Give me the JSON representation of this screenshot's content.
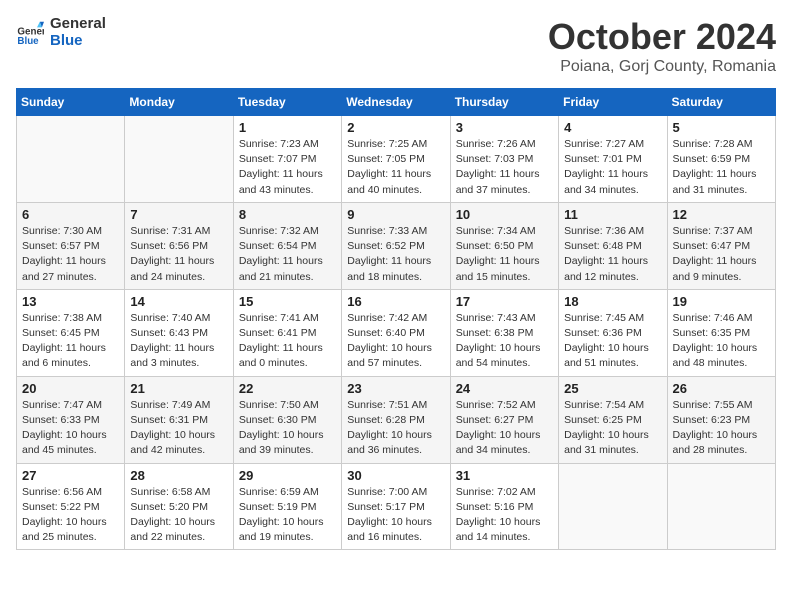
{
  "header": {
    "logo_general": "General",
    "logo_blue": "Blue",
    "month_title": "October 2024",
    "location": "Poiana, Gorj County, Romania"
  },
  "days_of_week": [
    "Sunday",
    "Monday",
    "Tuesday",
    "Wednesday",
    "Thursday",
    "Friday",
    "Saturday"
  ],
  "weeks": [
    [
      {
        "day": "",
        "sunrise": "",
        "sunset": "",
        "daylight": ""
      },
      {
        "day": "",
        "sunrise": "",
        "sunset": "",
        "daylight": ""
      },
      {
        "day": "1",
        "sunrise": "Sunrise: 7:23 AM",
        "sunset": "Sunset: 7:07 PM",
        "daylight": "Daylight: 11 hours and 43 minutes."
      },
      {
        "day": "2",
        "sunrise": "Sunrise: 7:25 AM",
        "sunset": "Sunset: 7:05 PM",
        "daylight": "Daylight: 11 hours and 40 minutes."
      },
      {
        "day": "3",
        "sunrise": "Sunrise: 7:26 AM",
        "sunset": "Sunset: 7:03 PM",
        "daylight": "Daylight: 11 hours and 37 minutes."
      },
      {
        "day": "4",
        "sunrise": "Sunrise: 7:27 AM",
        "sunset": "Sunset: 7:01 PM",
        "daylight": "Daylight: 11 hours and 34 minutes."
      },
      {
        "day": "5",
        "sunrise": "Sunrise: 7:28 AM",
        "sunset": "Sunset: 6:59 PM",
        "daylight": "Daylight: 11 hours and 31 minutes."
      }
    ],
    [
      {
        "day": "6",
        "sunrise": "Sunrise: 7:30 AM",
        "sunset": "Sunset: 6:57 PM",
        "daylight": "Daylight: 11 hours and 27 minutes."
      },
      {
        "day": "7",
        "sunrise": "Sunrise: 7:31 AM",
        "sunset": "Sunset: 6:56 PM",
        "daylight": "Daylight: 11 hours and 24 minutes."
      },
      {
        "day": "8",
        "sunrise": "Sunrise: 7:32 AM",
        "sunset": "Sunset: 6:54 PM",
        "daylight": "Daylight: 11 hours and 21 minutes."
      },
      {
        "day": "9",
        "sunrise": "Sunrise: 7:33 AM",
        "sunset": "Sunset: 6:52 PM",
        "daylight": "Daylight: 11 hours and 18 minutes."
      },
      {
        "day": "10",
        "sunrise": "Sunrise: 7:34 AM",
        "sunset": "Sunset: 6:50 PM",
        "daylight": "Daylight: 11 hours and 15 minutes."
      },
      {
        "day": "11",
        "sunrise": "Sunrise: 7:36 AM",
        "sunset": "Sunset: 6:48 PM",
        "daylight": "Daylight: 11 hours and 12 minutes."
      },
      {
        "day": "12",
        "sunrise": "Sunrise: 7:37 AM",
        "sunset": "Sunset: 6:47 PM",
        "daylight": "Daylight: 11 hours and 9 minutes."
      }
    ],
    [
      {
        "day": "13",
        "sunrise": "Sunrise: 7:38 AM",
        "sunset": "Sunset: 6:45 PM",
        "daylight": "Daylight: 11 hours and 6 minutes."
      },
      {
        "day": "14",
        "sunrise": "Sunrise: 7:40 AM",
        "sunset": "Sunset: 6:43 PM",
        "daylight": "Daylight: 11 hours and 3 minutes."
      },
      {
        "day": "15",
        "sunrise": "Sunrise: 7:41 AM",
        "sunset": "Sunset: 6:41 PM",
        "daylight": "Daylight: 11 hours and 0 minutes."
      },
      {
        "day": "16",
        "sunrise": "Sunrise: 7:42 AM",
        "sunset": "Sunset: 6:40 PM",
        "daylight": "Daylight: 10 hours and 57 minutes."
      },
      {
        "day": "17",
        "sunrise": "Sunrise: 7:43 AM",
        "sunset": "Sunset: 6:38 PM",
        "daylight": "Daylight: 10 hours and 54 minutes."
      },
      {
        "day": "18",
        "sunrise": "Sunrise: 7:45 AM",
        "sunset": "Sunset: 6:36 PM",
        "daylight": "Daylight: 10 hours and 51 minutes."
      },
      {
        "day": "19",
        "sunrise": "Sunrise: 7:46 AM",
        "sunset": "Sunset: 6:35 PM",
        "daylight": "Daylight: 10 hours and 48 minutes."
      }
    ],
    [
      {
        "day": "20",
        "sunrise": "Sunrise: 7:47 AM",
        "sunset": "Sunset: 6:33 PM",
        "daylight": "Daylight: 10 hours and 45 minutes."
      },
      {
        "day": "21",
        "sunrise": "Sunrise: 7:49 AM",
        "sunset": "Sunset: 6:31 PM",
        "daylight": "Daylight: 10 hours and 42 minutes."
      },
      {
        "day": "22",
        "sunrise": "Sunrise: 7:50 AM",
        "sunset": "Sunset: 6:30 PM",
        "daylight": "Daylight: 10 hours and 39 minutes."
      },
      {
        "day": "23",
        "sunrise": "Sunrise: 7:51 AM",
        "sunset": "Sunset: 6:28 PM",
        "daylight": "Daylight: 10 hours and 36 minutes."
      },
      {
        "day": "24",
        "sunrise": "Sunrise: 7:52 AM",
        "sunset": "Sunset: 6:27 PM",
        "daylight": "Daylight: 10 hours and 34 minutes."
      },
      {
        "day": "25",
        "sunrise": "Sunrise: 7:54 AM",
        "sunset": "Sunset: 6:25 PM",
        "daylight": "Daylight: 10 hours and 31 minutes."
      },
      {
        "day": "26",
        "sunrise": "Sunrise: 7:55 AM",
        "sunset": "Sunset: 6:23 PM",
        "daylight": "Daylight: 10 hours and 28 minutes."
      }
    ],
    [
      {
        "day": "27",
        "sunrise": "Sunrise: 6:56 AM",
        "sunset": "Sunset: 5:22 PM",
        "daylight": "Daylight: 10 hours and 25 minutes."
      },
      {
        "day": "28",
        "sunrise": "Sunrise: 6:58 AM",
        "sunset": "Sunset: 5:20 PM",
        "daylight": "Daylight: 10 hours and 22 minutes."
      },
      {
        "day": "29",
        "sunrise": "Sunrise: 6:59 AM",
        "sunset": "Sunset: 5:19 PM",
        "daylight": "Daylight: 10 hours and 19 minutes."
      },
      {
        "day": "30",
        "sunrise": "Sunrise: 7:00 AM",
        "sunset": "Sunset: 5:17 PM",
        "daylight": "Daylight: 10 hours and 16 minutes."
      },
      {
        "day": "31",
        "sunrise": "Sunrise: 7:02 AM",
        "sunset": "Sunset: 5:16 PM",
        "daylight": "Daylight: 10 hours and 14 minutes."
      },
      {
        "day": "",
        "sunrise": "",
        "sunset": "",
        "daylight": ""
      },
      {
        "day": "",
        "sunrise": "",
        "sunset": "",
        "daylight": ""
      }
    ]
  ]
}
